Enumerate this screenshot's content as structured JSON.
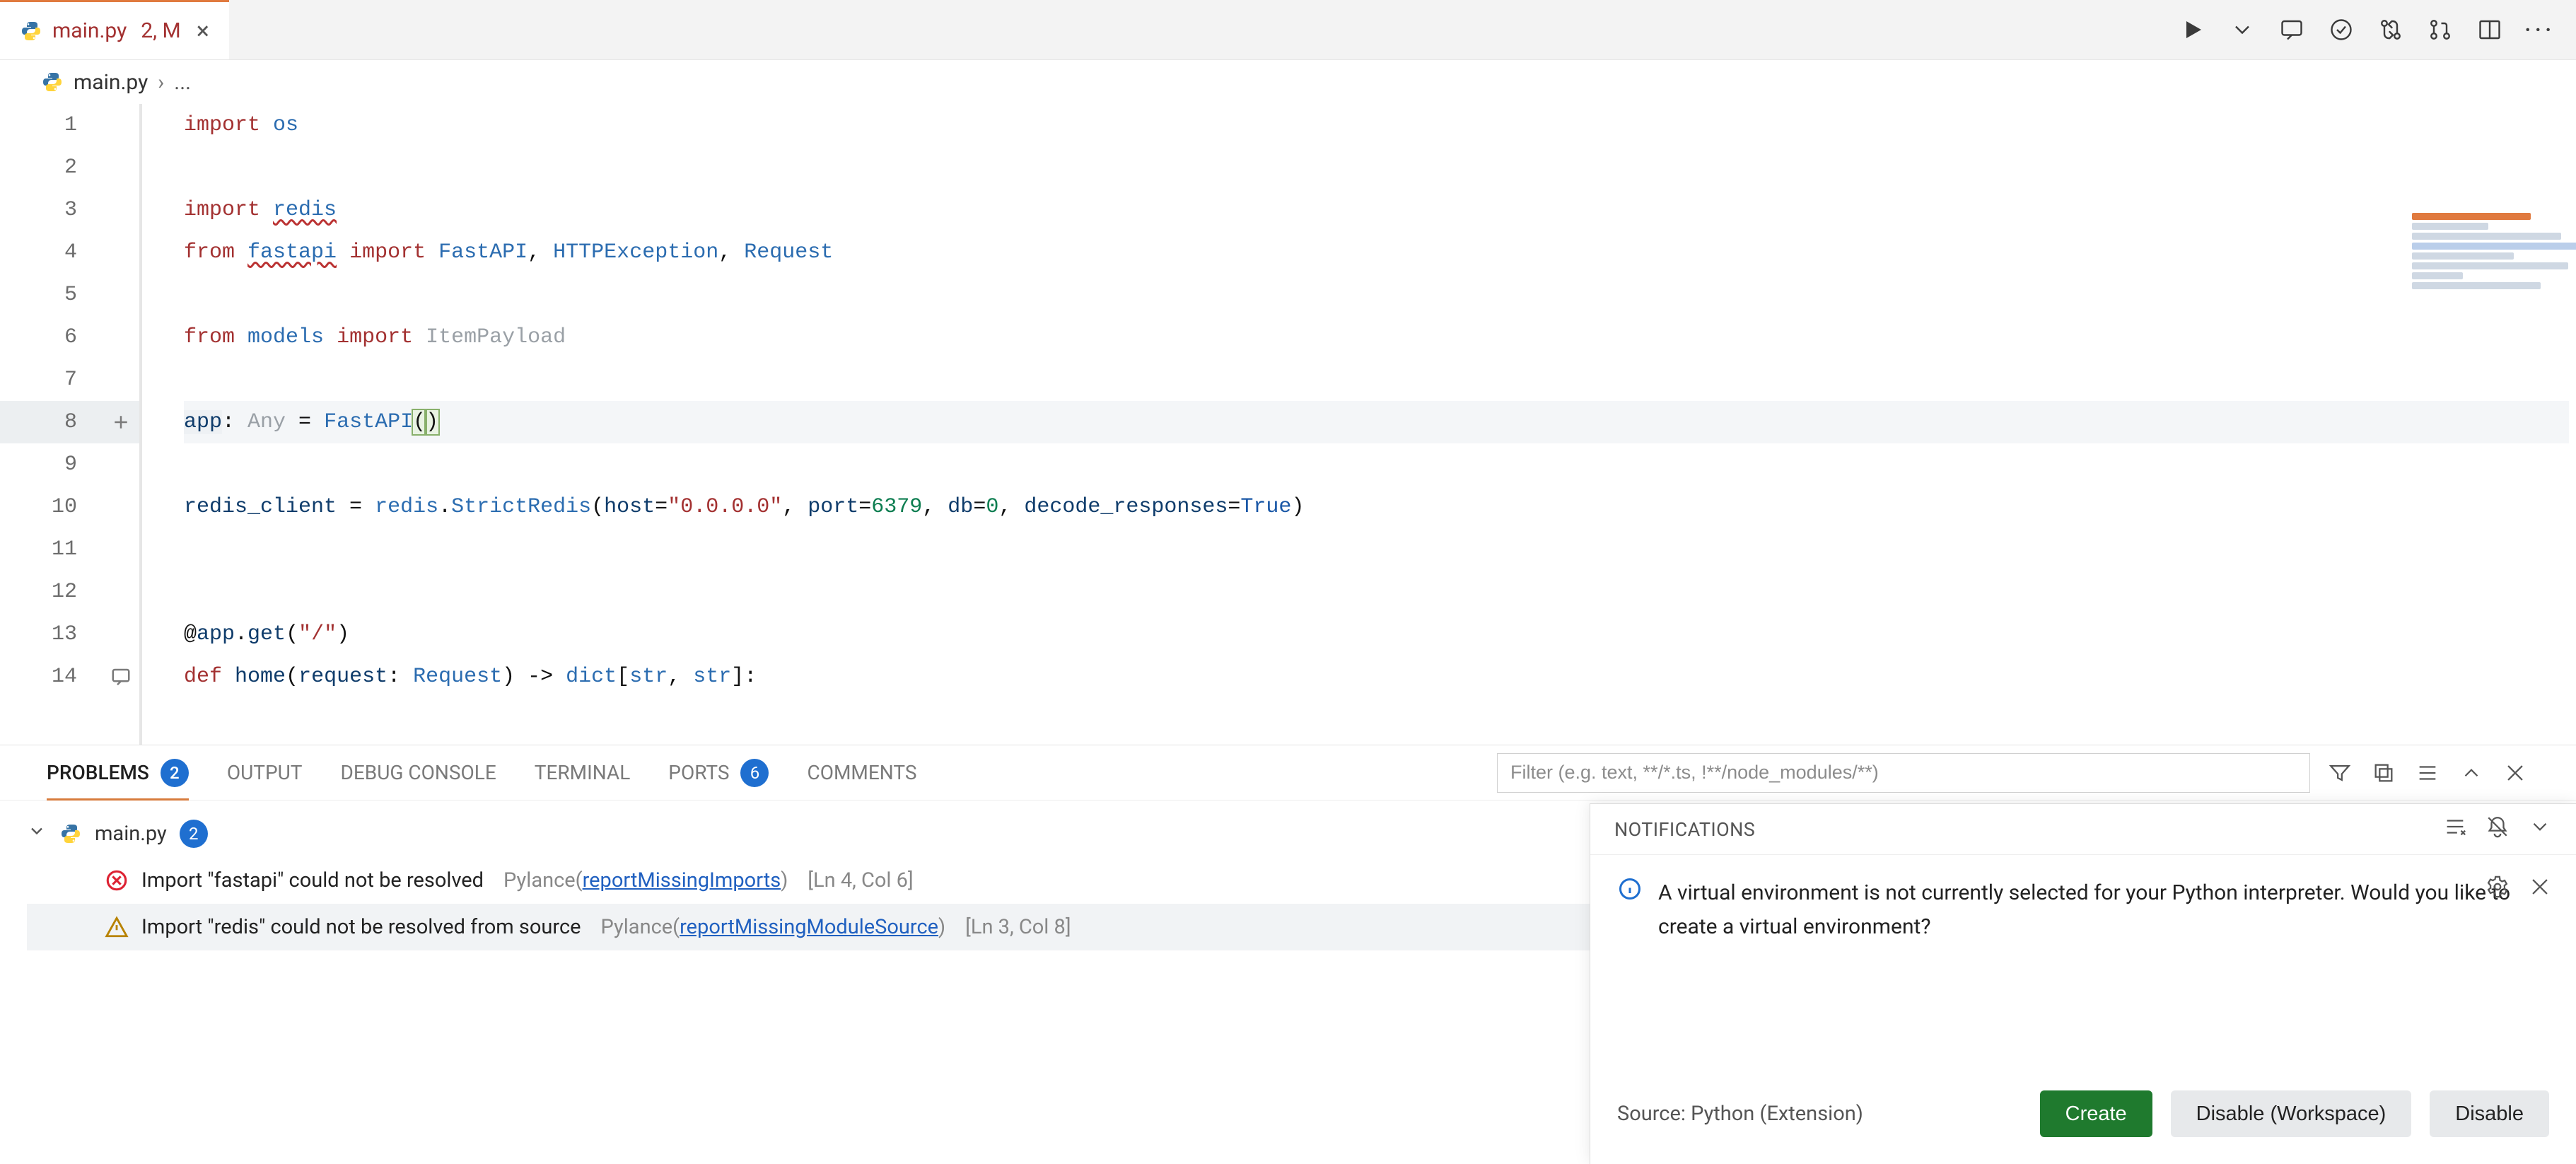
{
  "tab": {
    "file": "main.py",
    "meta": "2, M"
  },
  "breadcrumb": {
    "file": "main.py",
    "sep": "›",
    "more": "..."
  },
  "toolbar_icons": [
    "run-icon",
    "run-chevron-icon",
    "comment-icon",
    "check-icon",
    "git-compare-icon",
    "git-pr-icon",
    "split-editor-icon",
    "more-icon"
  ],
  "code": {
    "lines": [
      {
        "n": 1,
        "parts": [
          [
            "kw",
            "import"
          ],
          [
            "punct",
            " "
          ],
          [
            "mod",
            "os"
          ]
        ]
      },
      {
        "n": 2,
        "parts": []
      },
      {
        "n": 3,
        "parts": [
          [
            "kw",
            "import"
          ],
          [
            "punct",
            " "
          ],
          [
            "mod und",
            "redis"
          ]
        ]
      },
      {
        "n": 4,
        "parts": [
          [
            "kw",
            "from"
          ],
          [
            "punct",
            " "
          ],
          [
            "mod und-red",
            "fastapi"
          ],
          [
            "punct",
            " "
          ],
          [
            "kw",
            "import"
          ],
          [
            "punct",
            " "
          ],
          [
            "cls",
            "FastAPI"
          ],
          [
            "punct",
            ", "
          ],
          [
            "cls",
            "HTTPException"
          ],
          [
            "punct",
            ", "
          ],
          [
            "cls",
            "Request"
          ]
        ]
      },
      {
        "n": 5,
        "parts": []
      },
      {
        "n": 6,
        "parts": [
          [
            "kw",
            "from"
          ],
          [
            "punct",
            " "
          ],
          [
            "mod",
            "models"
          ],
          [
            "punct",
            " "
          ],
          [
            "kw",
            "import"
          ],
          [
            "punct",
            " "
          ],
          [
            "dim",
            "ItemPayload"
          ]
        ]
      },
      {
        "n": 7,
        "parts": []
      },
      {
        "n": 8,
        "cur": true,
        "glyph": "plus",
        "parts": [
          [
            "ident hl-gray",
            "app"
          ],
          [
            "punct",
            ": "
          ],
          [
            "dim",
            "Any"
          ],
          [
            "punct",
            " = "
          ],
          [
            "cls",
            "FastAPI"
          ],
          [
            "paren-match",
            "("
          ],
          [
            "paren-match",
            ")"
          ]
        ]
      },
      {
        "n": 9,
        "parts": []
      },
      {
        "n": 10,
        "parts": [
          [
            "ident",
            "redis_client"
          ],
          [
            "punct",
            " = "
          ],
          [
            "mod",
            "redis"
          ],
          [
            "punct",
            "."
          ],
          [
            "cls",
            "StrictRedis"
          ],
          [
            "punct",
            "("
          ],
          [
            "ident",
            "host"
          ],
          [
            "punct",
            "="
          ],
          [
            "str",
            "\"0.0.0.0\""
          ],
          [
            "punct",
            ", "
          ],
          [
            "ident",
            "port"
          ],
          [
            "punct",
            "="
          ],
          [
            "num",
            "6379"
          ],
          [
            "punct",
            ", "
          ],
          [
            "ident",
            "db"
          ],
          [
            "punct",
            "="
          ],
          [
            "num",
            "0"
          ],
          [
            "punct",
            ", "
          ],
          [
            "ident",
            "decode_responses"
          ],
          [
            "punct",
            "="
          ],
          [
            "bool",
            "True"
          ],
          [
            "punct",
            ")"
          ]
        ]
      },
      {
        "n": 11,
        "parts": []
      },
      {
        "n": 12,
        "parts": []
      },
      {
        "n": 13,
        "parts": [
          [
            "punct",
            "@"
          ],
          [
            "ident",
            "app"
          ],
          [
            "punct",
            "."
          ],
          [
            "ident",
            "get"
          ],
          [
            "punct",
            "("
          ],
          [
            "str",
            "\"/\""
          ],
          [
            "punct",
            ")"
          ]
        ]
      },
      {
        "n": 14,
        "glyph": "comment",
        "parts": [
          [
            "kw",
            "def"
          ],
          [
            "punct",
            " "
          ],
          [
            "ident",
            "home"
          ],
          [
            "punct",
            "("
          ],
          [
            "ident",
            "request"
          ],
          [
            "punct",
            ": "
          ],
          [
            "cls",
            "Request"
          ],
          [
            "punct",
            ") -> "
          ],
          [
            "cls",
            "dict"
          ],
          [
            "punct",
            "["
          ],
          [
            "cls",
            "str"
          ],
          [
            "punct",
            ", "
          ],
          [
            "cls",
            "str"
          ],
          [
            "punct",
            "]:"
          ]
        ]
      }
    ]
  },
  "panel": {
    "tabs": {
      "problems": "PROBLEMS",
      "problems_badge": "2",
      "output": "OUTPUT",
      "debug": "DEBUG CONSOLE",
      "terminal": "TERMINAL",
      "ports": "PORTS",
      "ports_badge": "6",
      "comments": "COMMENTS"
    },
    "filter_placeholder": "Filter (e.g. text, **/*.ts, !**/node_modules/**)",
    "file": "main.py",
    "file_badge": "2",
    "problems": [
      {
        "sev": "error",
        "msg": "Import \"fastapi\" could not be resolved",
        "src_prefix": "Pylance(",
        "src_link": "reportMissingImports",
        "src_suffix": ")",
        "loc": "[Ln 4, Col 6]",
        "selected": false
      },
      {
        "sev": "warning",
        "msg": "Import \"redis\" could not be resolved from source",
        "src_prefix": "Pylance(",
        "src_link": "reportMissingModuleSource",
        "src_suffix": ")",
        "loc": "[Ln 3, Col 8]",
        "selected": true
      }
    ]
  },
  "notif": {
    "title": "NOTIFICATIONS",
    "message": "A virtual environment is not currently selected for your Python interpreter. Would you like to create a virtual environment?",
    "source": "Source: Python (Extension)",
    "buttons": {
      "create": "Create",
      "disable_ws": "Disable (Workspace)",
      "disable": "Disable"
    }
  }
}
